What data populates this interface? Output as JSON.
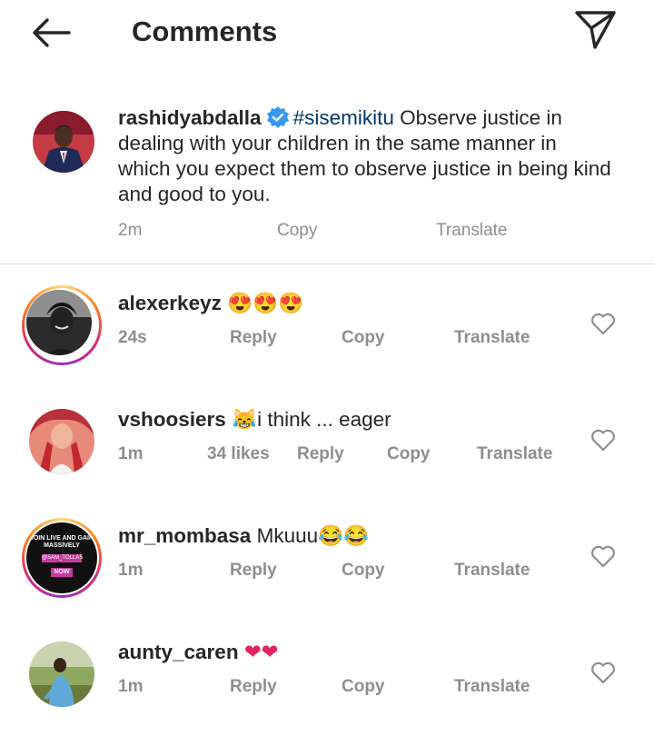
{
  "header": {
    "title": "Comments",
    "back_icon": "back-arrow-icon",
    "share_icon": "paper-plane-icon"
  },
  "caption": {
    "username": "rashidyabdalla",
    "hashtag": "#sisemikitu",
    "text": " Observe justice in dealing with your children in the same manner in which you expect them to observe justice in being kind and good to you.",
    "time": "2m",
    "copy": "Copy",
    "translate": "Translate"
  },
  "comments": [
    {
      "username": "alexerkeyz",
      "text": "😍😍😍",
      "time": "24s",
      "likes": "",
      "reply": "Reply",
      "copy": "Copy",
      "translate": "Translate"
    },
    {
      "username": "vshoosiers",
      "text": "😹i think ... eager",
      "time": "1m",
      "likes": "34 likes",
      "reply": "Reply",
      "copy": "Copy",
      "translate": "Translate"
    },
    {
      "username": "mr_mombasa",
      "text": "Mkuuu😂😂",
      "time": "1m",
      "likes": "",
      "reply": "Reply",
      "copy": "Copy",
      "translate": "Translate",
      "avatar_text": [
        "JOIN LIVE AND GAIN",
        "MASSIVELY",
        "@SAM_TOLLAS",
        "NOW"
      ]
    },
    {
      "username": "aunty_caren",
      "text": "❤❤",
      "time": "1m",
      "likes": "",
      "reply": "Reply",
      "copy": "Copy",
      "translate": "Translate"
    }
  ],
  "colors": {
    "meta": "#8e8e8e",
    "text": "#262626",
    "hashtag": "#00376b",
    "verified": "#3897f0",
    "divider": "#dbdbdb"
  }
}
